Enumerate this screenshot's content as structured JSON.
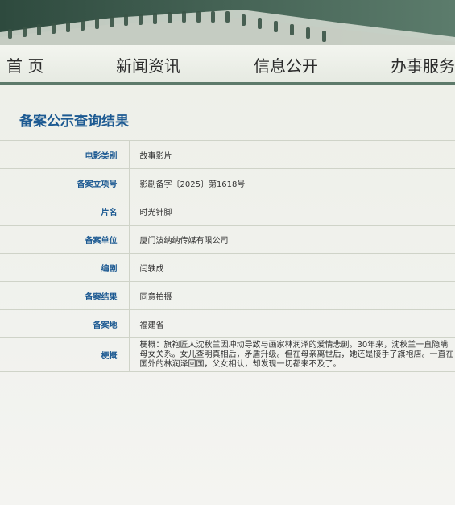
{
  "nav": {
    "items": [
      {
        "label": "首 页"
      },
      {
        "label": "新闻资讯"
      },
      {
        "label": "信息公开"
      },
      {
        "label": "办事服务"
      }
    ]
  },
  "page": {
    "title": "备案公示查询结果"
  },
  "record": {
    "rows": [
      {
        "label": "电影类别",
        "value": "故事影片"
      },
      {
        "label": "备案立项号",
        "value": "影剧备字〔2025〕第1618号"
      },
      {
        "label": "片名",
        "value": "时光针脚"
      },
      {
        "label": "备案单位",
        "value": "厦门波纳纳传媒有限公司"
      },
      {
        "label": "编剧",
        "value": "闫轶成"
      },
      {
        "label": "备案结果",
        "value": "同意拍摄"
      },
      {
        "label": "备案地",
        "value": "福建省"
      }
    ],
    "synopsis": {
      "label": "梗概",
      "value": "梗概：旗袍匠人沈秋兰因冲动导致与画家林润泽的爱情悲剧。30年来，沈秋兰一直隐瞒母女关系。女儿查明真相后，矛盾升级。但在母亲离世后，她还是接手了旗袍店。一直在国外的林润泽回国，父女相认，却发现一切都来不及了。"
    }
  },
  "colors": {
    "banner": "#3f5f50",
    "nav_border": "#5d7a6a",
    "label_blue": "#1d5a92"
  }
}
